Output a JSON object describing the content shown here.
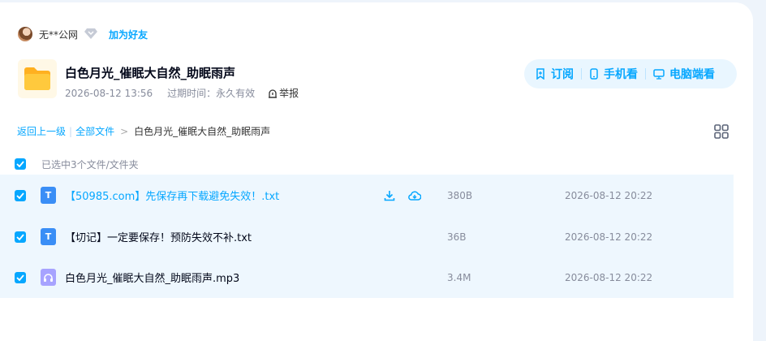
{
  "user": {
    "name": "无**公网",
    "add_friend": "加为好友"
  },
  "share": {
    "title": "白色月光_催眠大自然_助眠雨声",
    "created": "2026-08-12 13:56",
    "expiry_label": "过期时间：永久有效",
    "report": "举报"
  },
  "actions": {
    "subscribe": "订阅",
    "phone": "手机看",
    "pc": "电脑端看"
  },
  "breadcrumb": {
    "back": "返回上一级",
    "all": "全部文件",
    "current": "白色月光_催眠大自然_助眠雨声"
  },
  "selection": {
    "text": "已选中3个文件/文件夹"
  },
  "files": [
    {
      "name": "【50985.com】先保存再下载避免失效！.txt",
      "size": "380B",
      "date": "2026-08-12 20:22",
      "type": "txt",
      "icon_letter": "T"
    },
    {
      "name": "【切记】一定要保存！预防失效不补.txt",
      "size": "36B",
      "date": "2026-08-12 20:22",
      "type": "txt",
      "icon_letter": "T"
    },
    {
      "name": "白色月光_催眠大自然_助眠雨声.mp3",
      "size": "3.4M",
      "date": "2026-08-12 20:22",
      "type": "mp3",
      "icon_letter": ""
    }
  ],
  "colors": {
    "accent": "#06a7ff",
    "row_selected": "#eef7fe",
    "folder": "#ffc53d"
  }
}
